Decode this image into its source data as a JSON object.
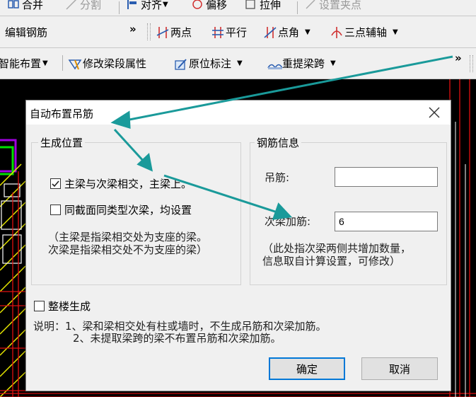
{
  "toolbar1": {
    "merge": "合并",
    "split": "分割",
    "align": "对齐",
    "offset": "偏移",
    "stretch": "拉伸",
    "set_point": "设置夹点"
  },
  "toolbar2": {
    "edit_rebar": "编辑钢筋",
    "overflow": "»",
    "two_points": "两点",
    "parallel": "平行",
    "point_angle": "点角",
    "three_point_axis": "三点辅轴"
  },
  "toolbar3": {
    "smart_layout": "智能布置",
    "modify_segment": "修改梁段属性",
    "in_situ_mark": "原位标注",
    "re_extract_span": "重提梁跨",
    "overflow": "»"
  },
  "dialog": {
    "title": "自动布置吊筋",
    "position_group": "生成位置",
    "opt_main_secondary": "主梁与次梁相交，主梁上。",
    "opt_main_secondary_checked": true,
    "opt_same_section": "同截面同类型次梁，均设置",
    "opt_same_section_checked": false,
    "note_main_1": "（主梁是指梁相交处为支座的梁。",
    "note_main_2": "次梁是指梁相交处不为支座的梁）",
    "rebar_group": "钢筋信息",
    "hanger_label": "吊筋:",
    "hanger_value": "",
    "secondary_label": "次梁加筋:",
    "secondary_value": "6",
    "note_rebar_1": "（此处指次梁两侧共增加数量，",
    "note_rebar_2": "信息取自计算设置，可修改）",
    "whole_building": "整楼生成",
    "whole_building_checked": false,
    "explain_1": "说明：1、梁和梁相交处有柱或墙时，不生成吊筋和次梁加筋。",
    "explain_2": "2、未提取梁跨的梁不布置吊筋和次梁加筋。",
    "ok": "确定",
    "cancel": "取消"
  },
  "colors": {
    "arrow": "#1a9a9a",
    "cad_background": "#000000",
    "cad_red": "#e01010",
    "cad_yellow": "#e8e800",
    "cad_green": "#00e000",
    "cad_purple": "#a000e0",
    "primary_border": "#0078d7"
  }
}
